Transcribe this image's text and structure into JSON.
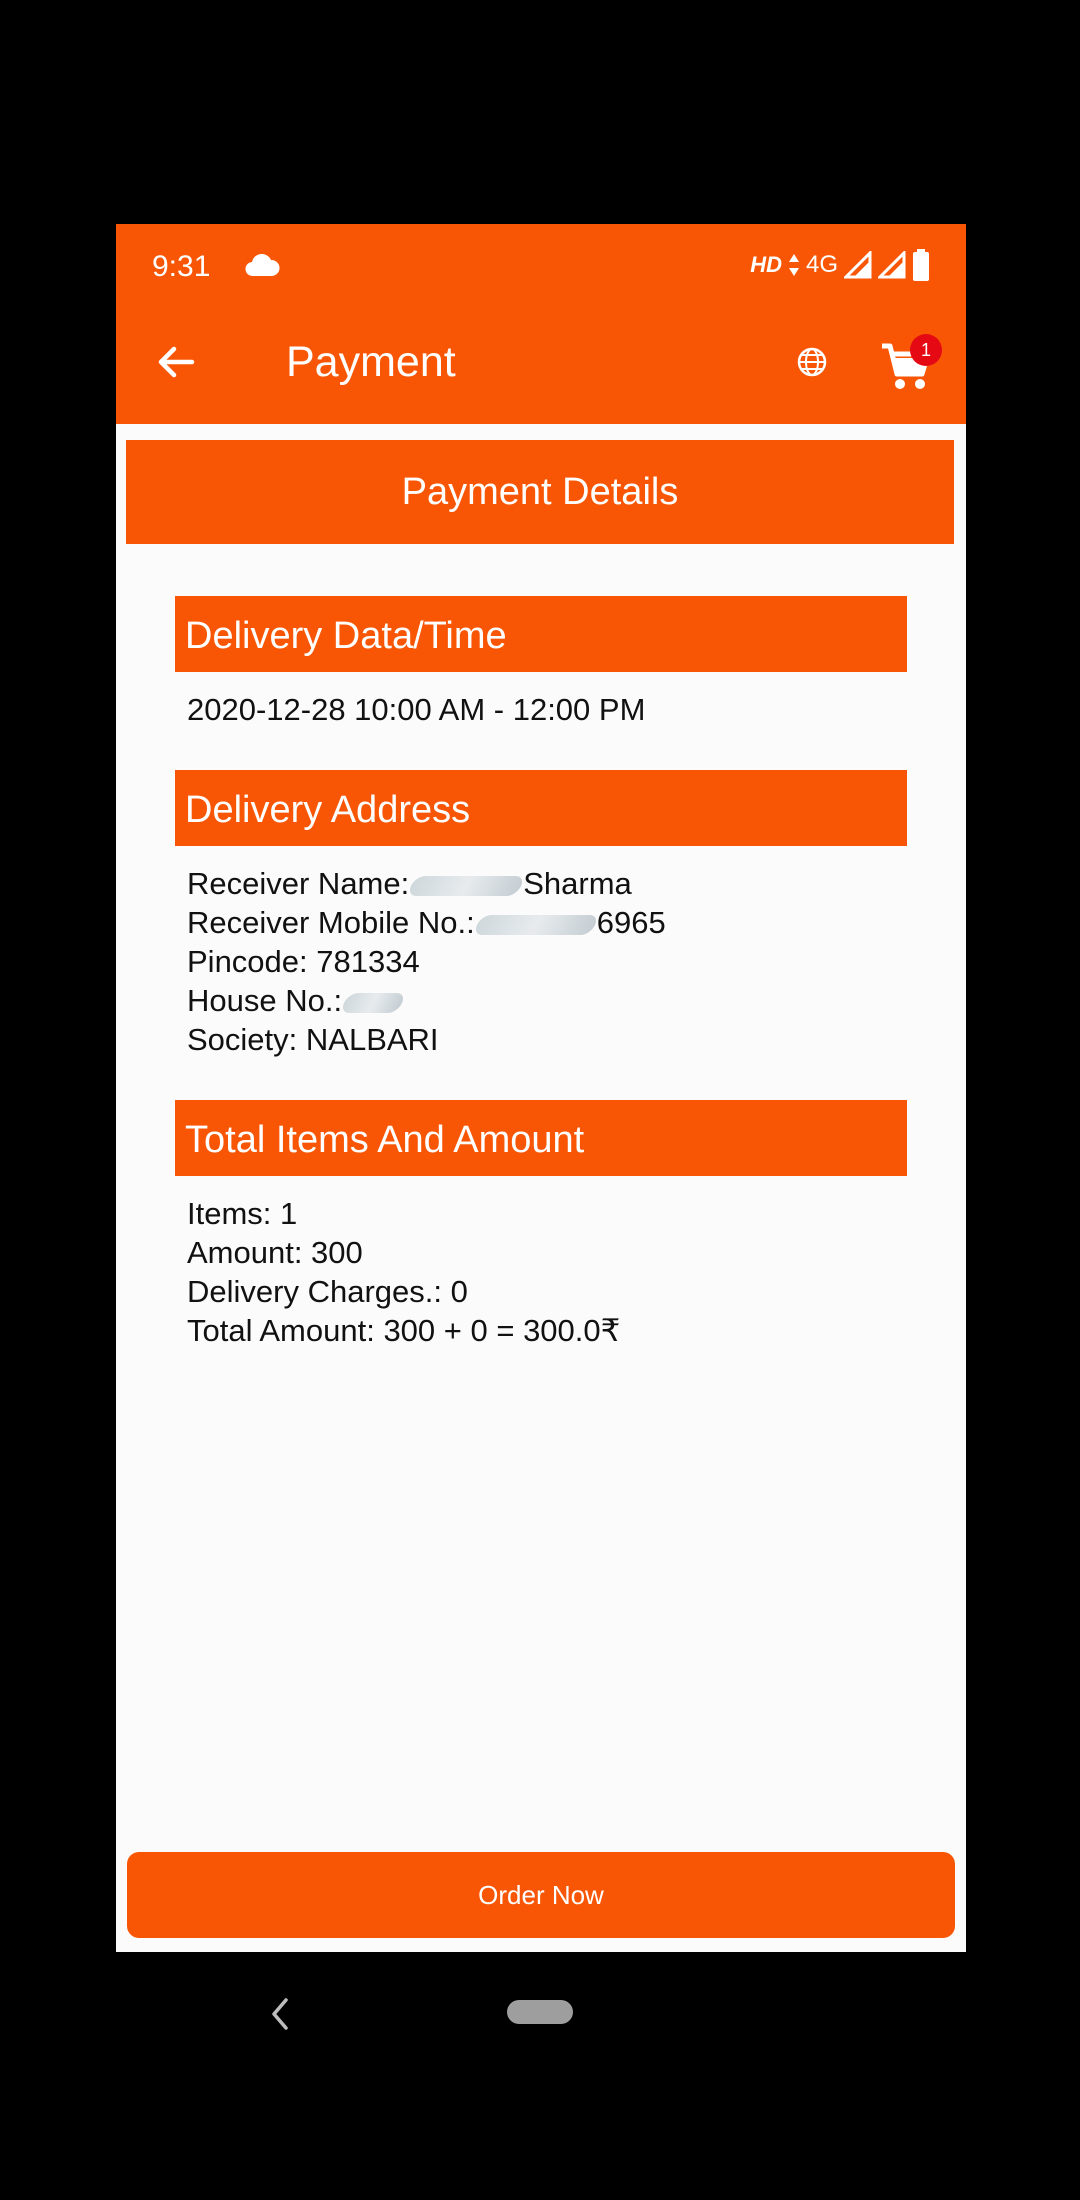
{
  "status_bar": {
    "time": "9:31",
    "hd": "HD",
    "network": "4G",
    "icons": [
      "cloud-icon",
      "data-arrows-icon",
      "signal-icon",
      "signal-icon",
      "battery-icon"
    ]
  },
  "toolbar": {
    "title": "Payment",
    "back_icon": "arrow-left-icon",
    "globe_icon": "globe-icon",
    "cart_icon": "cart-icon",
    "cart_badge": "1"
  },
  "card": {
    "header": "Payment Details"
  },
  "delivery_time": {
    "title": "Delivery Data/Time",
    "value": "2020-12-28 10:00 AM - 12:00 PM"
  },
  "delivery_address": {
    "title": "Delivery Address",
    "receiver_name_label": "Receiver Name:",
    "receiver_name_visible": "Sharma",
    "receiver_mobile_label": "Receiver Mobile No.:",
    "receiver_mobile_visible": "6965",
    "pincode": "Pincode: 781334",
    "house_label": "House No.:",
    "society": "Society: NALBARI"
  },
  "totals": {
    "title": "Total Items And Amount",
    "items": "Items: 1",
    "amount": "Amount: 300",
    "delivery_charges": "Delivery Charges.: 0",
    "total": "Total Amount: 300 + 0 = 300.0₹"
  },
  "order_button": {
    "label": "Order Now"
  },
  "colors": {
    "accent": "#f85605",
    "badge": "#e50914",
    "background": "#fbfbfb"
  }
}
